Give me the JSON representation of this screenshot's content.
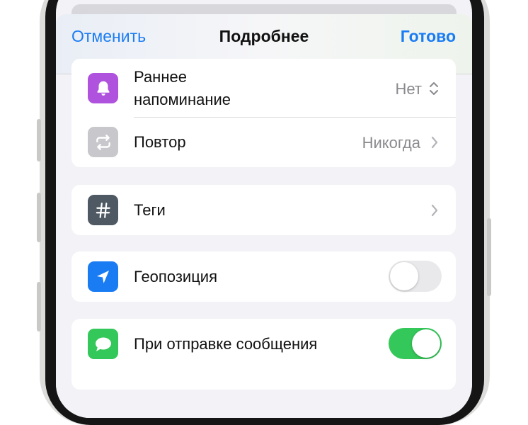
{
  "navbar": {
    "cancel": "Отменить",
    "title": "Подробнее",
    "done": "Готово"
  },
  "rows": {
    "early_reminder": {
      "label_line1": "Раннее",
      "label_line2": "напоминание",
      "value": "Нет",
      "icon": "bell-icon",
      "icon_color": "#af52de"
    },
    "repeat": {
      "label": "Повтор",
      "value": "Никогда",
      "icon": "repeat-icon",
      "icon_color": "#c7c7cc"
    },
    "tags": {
      "label": "Теги",
      "icon": "hashtag-icon",
      "icon_color": "#4f5963"
    },
    "location": {
      "label": "Геопозиция",
      "toggle": false,
      "icon": "location-arrow-icon",
      "icon_color": "#1a7cf3"
    },
    "messaging": {
      "label": "При отправке сообщения",
      "toggle": true,
      "icon": "message-bubble-icon",
      "icon_color": "#34c759"
    }
  }
}
